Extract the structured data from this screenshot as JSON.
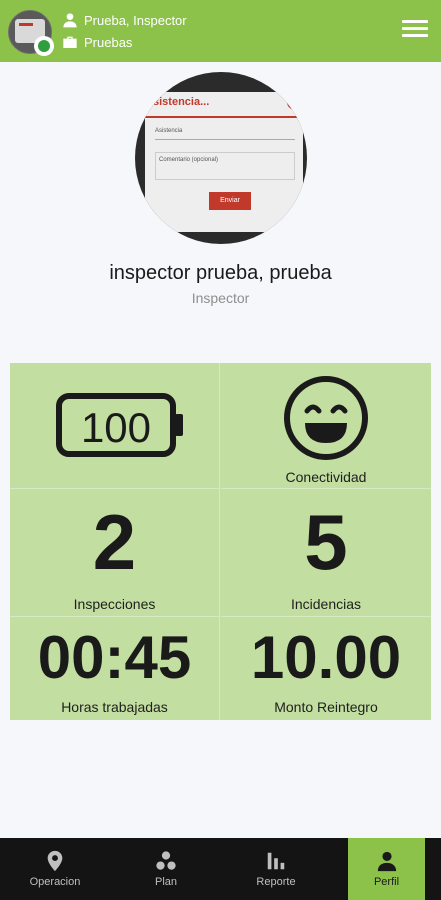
{
  "header": {
    "user_name": "Prueba, Inspector",
    "group": "Pruebas",
    "icons": {
      "user": "person-icon",
      "group": "briefcase-icon",
      "menu": "hamburger-menu-icon"
    }
  },
  "profile": {
    "full_name": "inspector prueba, prueba",
    "role": "Inspector",
    "photo": {
      "title_text": "sistencia...",
      "field_text": "Asistencia",
      "comment_text": "Comentario (opcional)",
      "button_text": "Enviar"
    }
  },
  "stats": {
    "battery": {
      "value": "100",
      "icon": "battery-icon"
    },
    "connectivity": {
      "label": "Conectividad",
      "icon": "smiley-face-icon"
    },
    "inspections": {
      "value": "2",
      "label": "Inspecciones"
    },
    "incidents": {
      "value": "5",
      "label": "Incidencias"
    },
    "hours": {
      "value": "00:45",
      "label": "Horas trabajadas"
    },
    "reimbursement": {
      "value": "10.00",
      "label": "Monto Reintegro"
    }
  },
  "nav": {
    "items": [
      {
        "label": "Operacion",
        "icon": "map-pin-icon"
      },
      {
        "label": "Plan",
        "icon": "dots-cluster-icon"
      },
      {
        "label": "Reporte",
        "icon": "bar-chart-icon"
      },
      {
        "label": "Perfil",
        "icon": "person-icon"
      }
    ],
    "active": "Perfil"
  },
  "colors": {
    "accent": "#8cc14a",
    "grid_bg": "#c2dea0",
    "nav_bg": "#141414",
    "status_online": "#2e9e3f"
  }
}
